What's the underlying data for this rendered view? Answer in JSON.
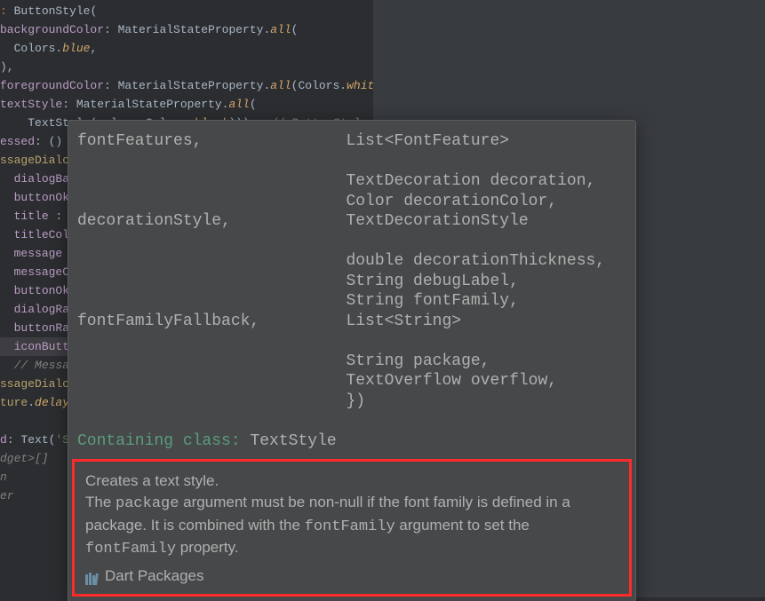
{
  "code": {
    "l1_partial": ": ",
    "l1_class": "ButtonStyle",
    "l1_paren": "(",
    "l2_param": "backgroundColor",
    "l2_rest": ": MaterialStateProperty.",
    "l2_all": "all",
    "l2_paren": "(",
    "l3_colors": "Colors",
    "l3_dot": ".",
    "l3_blue": "blue",
    "l3_comma": ",",
    "l4_close": "),",
    "l5_param": "foregroundColor",
    "l5_rest": ": MaterialStateProperty.",
    "l5_all": "all",
    "l5_mid": "(Colors.",
    "l5_white": "white",
    "l5_end": "),",
    "l6_param": "textStyle",
    "l6_rest": ": MaterialStateProperty.",
    "l6_all": "all",
    "l6_paren": "(",
    "l7_textstyle": "TextStyle",
    "l7_mid": "(",
    "l7_color": "color",
    "l7_rest": ": Colors.",
    "l7_black": "black",
    "l7_end": "))),  ",
    "l7_comment": "// ButtonStyle",
    "l8_a": "essed",
    "l8_b": ": () a",
    "l9": "ssageDialog",
    "l10": "dialogBac",
    "l11": "buttonOkC",
    "l12_a": "title",
    "l12_b": " : '",
    "l13": "titleCol",
    "l14_a": "message",
    "l14_b": " :",
    "l15": "messageCo",
    "l16": "buttonOkT",
    "l17": "dialogRad",
    "l18": "buttonRad",
    "l19": "iconButto",
    "l20": "// Messag",
    "l21": "ssageDialog",
    "l22_a": "ture",
    "l22_b": ".",
    "l22_c": "delaye",
    "l23_a": "d",
    "l23_b": ": ",
    "l23_c": "Text",
    "l23_d": "(",
    "l23_e": "'Sh",
    "l24": "dget>[]",
    "l25": "n",
    "l26": "er"
  },
  "tooltip": {
    "params": "fontFeatures,               List<FontFeature>\n\n                            TextDecoration decoration,\n                            Color decorationColor,\ndecorationStyle,            TextDecorationStyle\n\n                            double decorationThickness,\n                            String debugLabel,\n                            String fontFamily,\nfontFamilyFallback,         List<String>\n\n                            String package,\n                            TextOverflow overflow,\n                            })",
    "meta_label": "Containing class:",
    "meta_value": "TextStyle",
    "doc_intro": "Creates a text style.",
    "doc_prefix": "The ",
    "doc_code1": "package",
    "doc_mid1": " argument must be non-null if the font family is defined in a package. It is combined with the ",
    "doc_code2": "fontFamily",
    "doc_mid2": " argument to set the ",
    "doc_code3": "fontFamily",
    "doc_end": " property.",
    "pkg_link": "Dart Packages"
  }
}
